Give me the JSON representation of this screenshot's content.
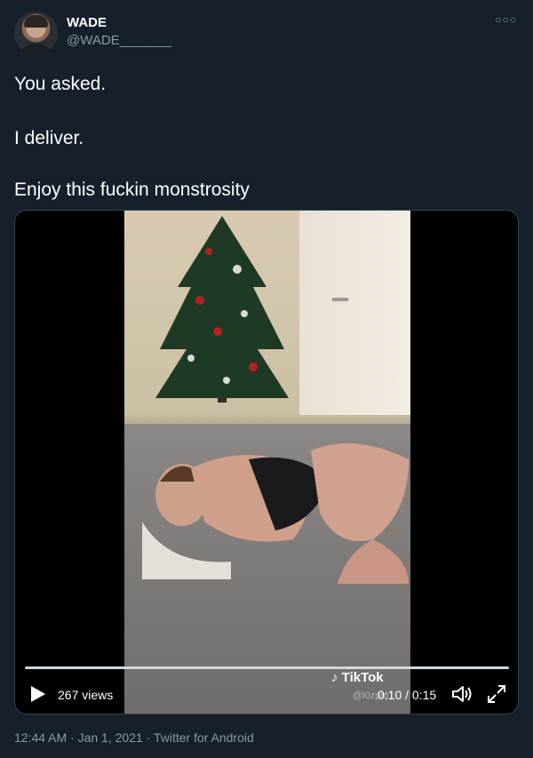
{
  "tweet": {
    "author_name": "WADE",
    "author_handle": "@WADE_______",
    "more_icon": "ellipsis-icon",
    "lines": [
      "You asked.",
      "I deliver.",
      "Enjoy this fuckin monstrosity"
    ],
    "timestamp": "12:44 AM · Jan 1, 2021 · Twitter for Android"
  },
  "video": {
    "views": "267 views",
    "time": "0:10 / 0:15",
    "progress": 0.667,
    "watermark": "TikTok",
    "watermark_user": "@l0zpm",
    "icons": [
      "play-icon",
      "volume-icon",
      "expand-icon"
    ]
  },
  "colors": {
    "background": "#15202b",
    "secondary_text": "#8899a6",
    "border": "#38444d"
  }
}
